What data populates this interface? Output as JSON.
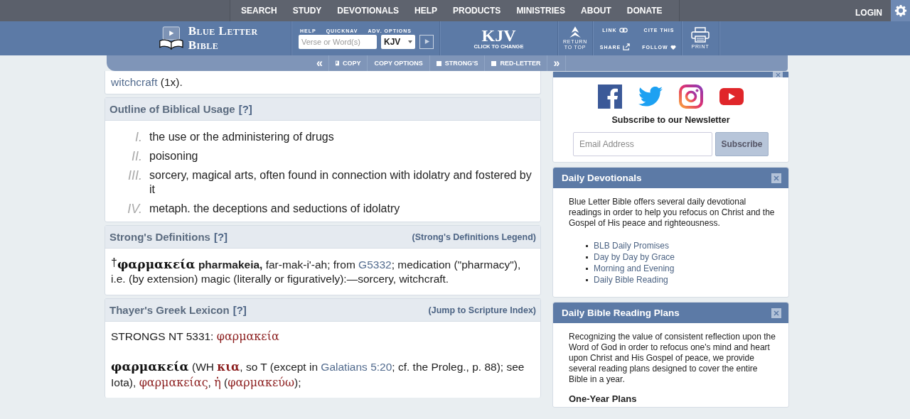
{
  "nav": {
    "items": [
      {
        "label": "SEARCH"
      },
      {
        "label": "STUDY"
      },
      {
        "label": "DEVOTIONALS"
      },
      {
        "label": "HELP"
      },
      {
        "label": "PRODUCTS"
      },
      {
        "label": "MINISTRIES"
      },
      {
        "label": "ABOUT"
      },
      {
        "label": "DONATE"
      }
    ],
    "login": "LOGIN"
  },
  "header": {
    "logo": "Blue Letter Bible",
    "search_labels": [
      "HELP",
      "QUICKNAV",
      "ADV. OPTIONS"
    ],
    "search": {
      "placeholder": "Verse or Word(s)"
    },
    "version_select": "KJV",
    "version": {
      "label": "KJV",
      "sub": "CLICK TO CHANGE"
    },
    "return_to_top": "RETURN TO TOP",
    "links": [
      {
        "label": "LINK",
        "kind": "link"
      },
      {
        "label": "CITE THIS",
        "kind": "plain"
      },
      {
        "label": "SHARE",
        "kind": "share"
      },
      {
        "label": "FOLLOW",
        "kind": "heart"
      }
    ],
    "print": "PRINT"
  },
  "toolbar": [
    {
      "kind": "prev",
      "label": "«"
    },
    {
      "kind": "copy",
      "label": "COPY"
    },
    {
      "kind": "button",
      "label": "COPY OPTIONS"
    },
    {
      "kind": "checkbox",
      "label": "STRONG'S",
      "checked": false
    },
    {
      "kind": "checkbox",
      "label": "RED-LETTER",
      "checked": false
    },
    {
      "kind": "next",
      "label": "»"
    }
  ],
  "top_card": {
    "segments": [
      {
        "kind": "link",
        "text": "witchcraft"
      },
      {
        "kind": "text",
        "text": " (1x)."
      }
    ]
  },
  "outline": {
    "title": "Outline of Biblical Usage",
    "help": "[?]",
    "items": [
      {
        "numeral": "I.",
        "text": "the use or the administering of drugs"
      },
      {
        "numeral": "II.",
        "text": "poisoning"
      },
      {
        "numeral": "III.",
        "text": "sorcery, magical arts, often found in connection with idolatry and fostered by it"
      },
      {
        "numeral": "IV.",
        "text": "metaph. the deceptions and seductions of idolatry"
      }
    ]
  },
  "strongs": {
    "title": "Strong's Definitions",
    "help": "[?]",
    "legend": "(Strong's Definitions Legend)",
    "segments": [
      {
        "kind": "dagger",
        "text": "†"
      },
      {
        "kind": "greek",
        "text": "φαρμακεία"
      },
      {
        "kind": "bold",
        "text": " pharmakeia,"
      },
      {
        "kind": "text",
        "text": " far-mak-i'-ah; from "
      },
      {
        "kind": "link",
        "text": "G5332"
      },
      {
        "kind": "text",
        "text": "; medication (\"pharmacy\"), i.e. (by extension) magic (literally or figuratively):—sorcery, witchcraft."
      }
    ]
  },
  "thayer": {
    "title": "Thayer's Greek Lexicon",
    "help": "[?]",
    "legend": "(Jump to Scripture Index)",
    "paragraphs": [
      [
        {
          "kind": "text",
          "text": "STRONGS NT 5331: "
        },
        {
          "kind": "greek-red",
          "text": "φαρμακεία"
        }
      ],
      [
        {
          "kind": "greek",
          "text": "φαρμακεία"
        },
        {
          "kind": "text",
          "text": " (WH "
        },
        {
          "kind": "greek-red-bold",
          "text": "κια"
        },
        {
          "kind": "text",
          "text": ", so T (except in "
        },
        {
          "kind": "link",
          "text": "Galatians 5:20"
        },
        {
          "kind": "text",
          "text": "; cf. the Proleg., p. 88); see Iota), "
        },
        {
          "kind": "greek-red",
          "text": "φαρμακείας"
        },
        {
          "kind": "text",
          "text": ", "
        },
        {
          "kind": "greek-red",
          "text": "ἡ"
        },
        {
          "kind": "text",
          "text": " ("
        },
        {
          "kind": "greek-red",
          "text": "φαρμακεύω"
        },
        {
          "kind": "text",
          "text": ");"
        }
      ]
    ]
  },
  "social": {
    "icons": [
      {
        "kind": "facebook"
      },
      {
        "kind": "twitter"
      },
      {
        "kind": "instagram"
      },
      {
        "kind": "youtube"
      }
    ],
    "newsletter_title": "Subscribe to our Newsletter",
    "email": {
      "placeholder": "Email Address"
    },
    "button": "Subscribe"
  },
  "devotionals": {
    "title": "Daily Devotionals",
    "text": "Blue Letter Bible offers several daily devotional readings in order to help you refocus on Christ and the Gospel of His peace and righteousness.",
    "links": [
      "BLB Daily Promises",
      "Day by Day by Grace",
      "Morning and Evening",
      "Daily Bible Reading"
    ]
  },
  "plans": {
    "title": "Daily Bible Reading Plans",
    "text": "Recognizing the value of consistent reflection upon the Word of God in order to refocus one's mind and heart upon Christ and His Gospel of peace, we provide several reading plans designed to cover the entire Bible in a year.",
    "subheading": "One-Year Plans"
  }
}
